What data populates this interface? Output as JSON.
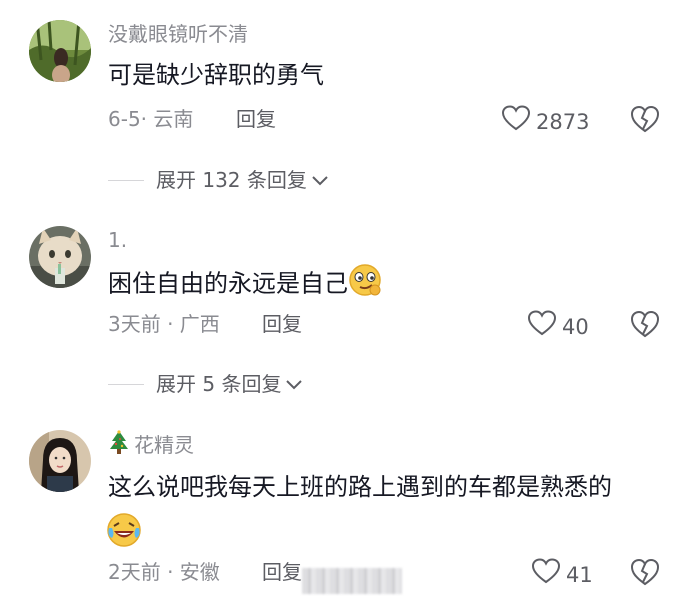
{
  "comments": [
    {
      "username": "没戴眼镜听不清",
      "text": "可是缺少辞职的勇气",
      "date_location": "6-5· 云南",
      "reply_label": "回复",
      "like_count": "2873",
      "expand_label": "展开 132 条回复"
    },
    {
      "username": "1.",
      "text": "困住自由的永远是自己",
      "date_location": "3天前 · 广西",
      "reply_label": "回复",
      "like_count": "40",
      "expand_label": "展开 5 条回复"
    },
    {
      "username": "花精灵",
      "text": "这么说吧我每天上班的路上遇到的车都是熟悉的",
      "date_location": "2天前 · 安徽",
      "reply_label": "回复",
      "like_count": "41"
    }
  ],
  "icons": {
    "like": "heart-outline-icon",
    "dislike": "broken-heart-icon",
    "expand": "chevron-down-icon",
    "badge": "christmas-tree-icon"
  },
  "colors": {
    "text": "#161823",
    "secondary": "#8a8b91",
    "action": "#5c5d63"
  }
}
